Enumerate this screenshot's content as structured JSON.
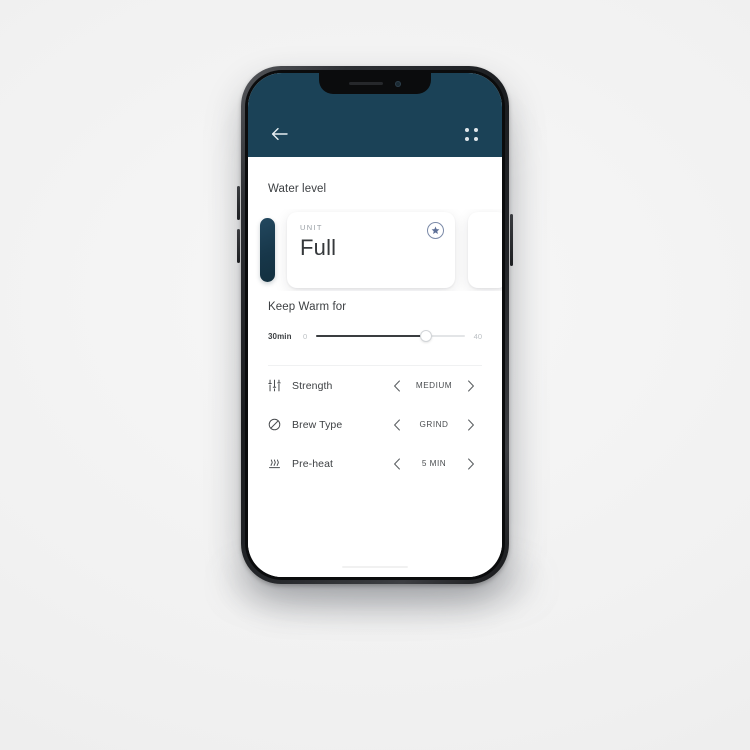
{
  "background": {
    "color": "#f2f2f2"
  },
  "device": {
    "frame_color": "#1b1d20",
    "screen_bg": "#ffffff"
  },
  "appbar": {
    "bg_color": "#1b4257",
    "back_icon": "arrow-left-icon",
    "grid_icon": "grid-dots-icon"
  },
  "water_level": {
    "section_title": "Water level",
    "cards": [
      {
        "type": "collapsed-pill",
        "color": "#17374a"
      },
      {
        "type": "active",
        "unit_label": "UNIT",
        "value": "Full",
        "badge_icon": "star-circle-icon",
        "badge_color": "#7b8aa8"
      },
      {
        "type": "peek"
      }
    ]
  },
  "keep_warm": {
    "title": "Keep Warm for",
    "amount": "30min",
    "min": "0",
    "max": "40",
    "value": 30,
    "range_min": 0,
    "range_max": 40,
    "fill_percent": 74
  },
  "options": [
    {
      "icon": "tune-icon",
      "label": "Strength",
      "value": "MEDIUM",
      "prev_icon": "chevron-left-icon",
      "next_icon": "chevron-right-icon"
    },
    {
      "icon": "block-circle-icon",
      "label": "Brew Type",
      "value": "GRIND",
      "prev_icon": "chevron-left-icon",
      "next_icon": "chevron-right-icon"
    },
    {
      "icon": "heat-waves-icon",
      "label": "Pre-heat",
      "value": "5 MIN",
      "prev_icon": "chevron-left-icon",
      "next_icon": "chevron-right-icon"
    }
  ]
}
